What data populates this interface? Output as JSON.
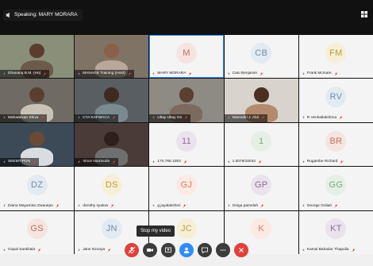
{
  "top": {
    "speaking_label": "Speaking: MARY MORARA"
  },
  "tooltip": "Stop my video",
  "tiles": [
    {
      "name": "Dhanaraj B.M. (Ho)",
      "type": "video"
    },
    {
      "name": "MANAGE Training (Host)",
      "type": "video"
    },
    {
      "name": "MARY MORARA",
      "type": "avatar",
      "initials": "M",
      "active": true
    },
    {
      "name": "Catu Benjamin",
      "type": "avatar",
      "initials": "CB"
    },
    {
      "name": "Frank Mcmare",
      "type": "avatar",
      "initials": "FM"
    },
    {
      "name": "Mahadevan Shiva",
      "type": "video"
    },
    {
      "name": "CTA KAFWACA",
      "type": "video"
    },
    {
      "name": "Ultay Ultay Oo",
      "type": "video"
    },
    {
      "name": "Mwendiri J. Abii",
      "type": "video"
    },
    {
      "name": "R Venkatlakshma",
      "type": "avatar",
      "initials": "RV"
    },
    {
      "name": "SEEMT-PUN",
      "type": "video"
    },
    {
      "name": "Vince Namnode",
      "type": "video"
    },
    {
      "name": "170.768.1053",
      "type": "avatar",
      "initials": "11"
    },
    {
      "name": "1.0079/10033",
      "type": "avatar",
      "initials": "1"
    },
    {
      "name": "Rugambe Richard",
      "type": "avatar",
      "initials": "BR"
    },
    {
      "name": "Diana Mayamiso Zwaoepo",
      "type": "avatar",
      "initials": "DZ"
    },
    {
      "name": "dorothy syalow",
      "type": "avatar",
      "initials": "DS"
    },
    {
      "name": "g.jayalakshmi",
      "type": "avatar",
      "initials": "GJ"
    },
    {
      "name": "Geiga pamelah",
      "type": "avatar",
      "initials": "GP"
    },
    {
      "name": "George Goliati",
      "type": "avatar",
      "initials": "GG"
    },
    {
      "name": "Gopal Sankhala",
      "type": "avatar",
      "initials": "GS"
    },
    {
      "name": "Jane Nzooya",
      "type": "avatar",
      "initials": "JN"
    },
    {
      "name": "",
      "type": "avatar",
      "initials": "JC"
    },
    {
      "name": "",
      "type": "avatar",
      "initials": "K"
    },
    {
      "name": "Kamal Bahadur Thapulia",
      "type": "avatar",
      "initials": "KT"
    }
  ],
  "controls": [
    {
      "icon": "mic-off-icon",
      "label": "Unmute"
    },
    {
      "icon": "video-icon",
      "label": "Stop my video"
    },
    {
      "icon": "share-screen-icon",
      "label": "Share"
    },
    {
      "icon": "participants-icon",
      "label": "Participants"
    },
    {
      "icon": "chat-icon",
      "label": "Chat"
    },
    {
      "icon": "more-icon",
      "label": "More"
    },
    {
      "icon": "end-call-icon",
      "label": "Leave"
    }
  ],
  "colors": {
    "active_border": "#2d8cff",
    "end_call": "#e0413a",
    "tile_bg": "#f4f4f4"
  }
}
